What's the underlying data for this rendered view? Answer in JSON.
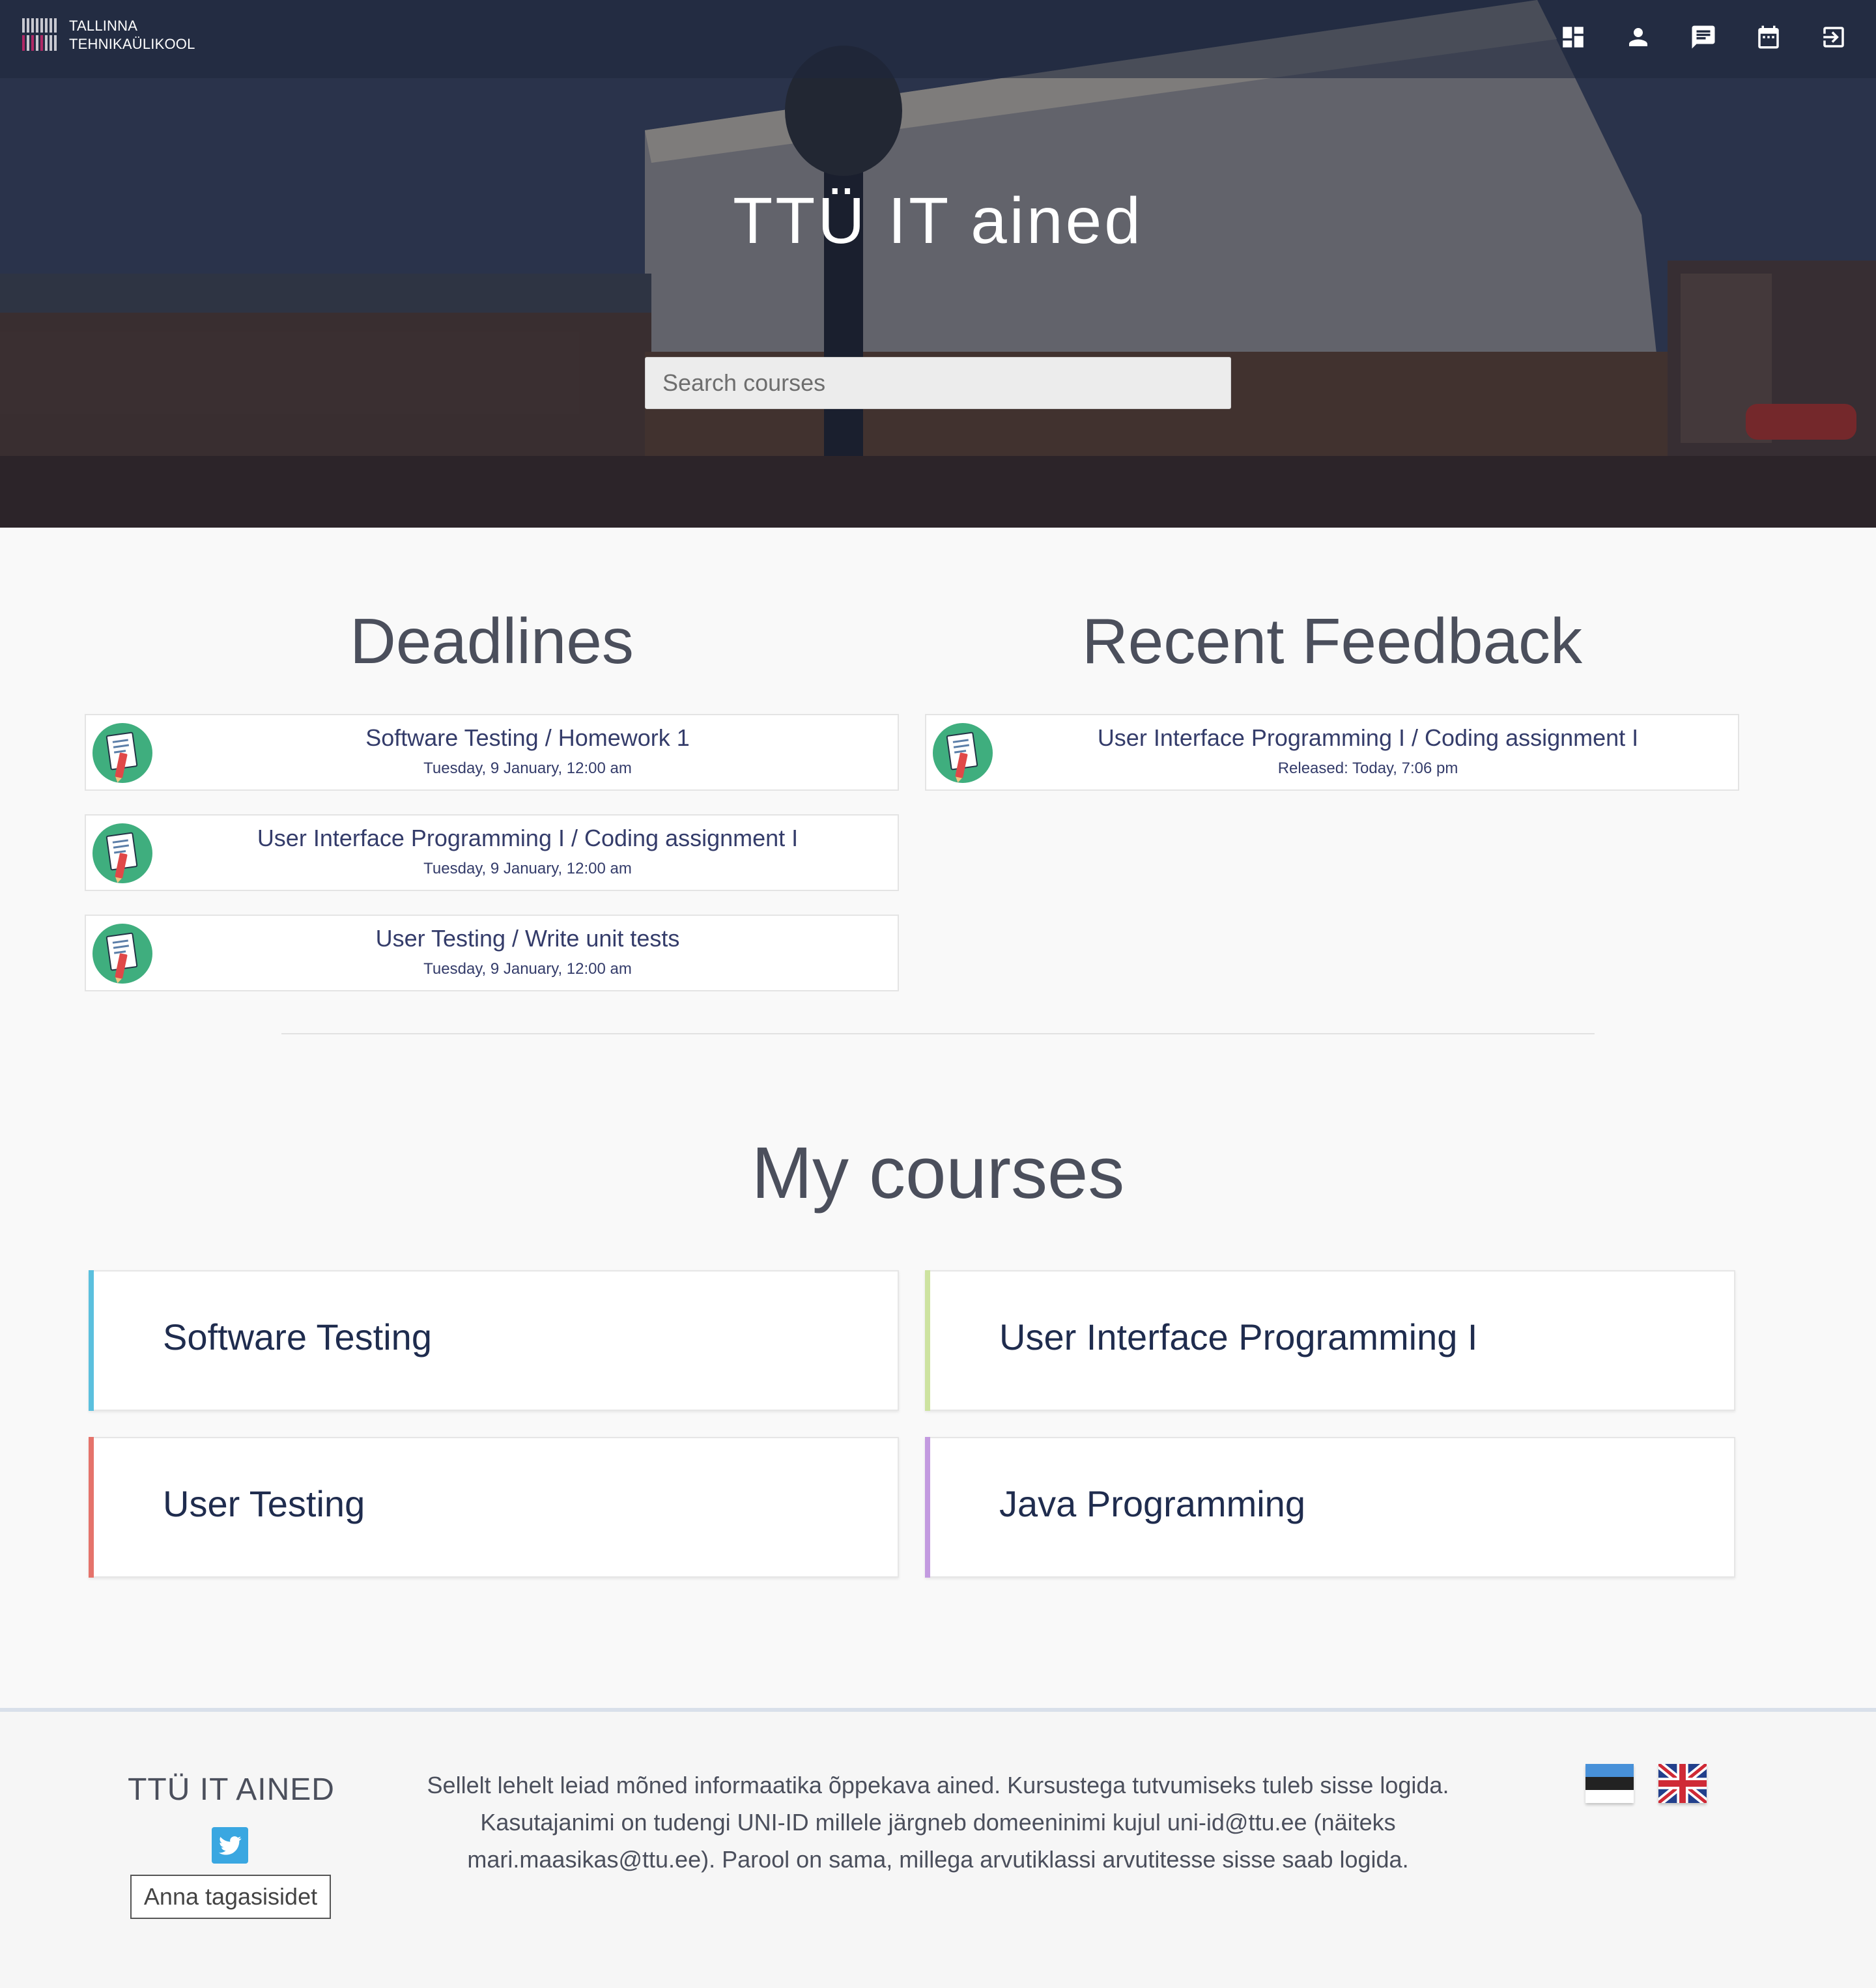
{
  "header": {
    "logo_line1": "TALLINNA",
    "logo_line2": "TEHNIKAÜLIKOOL",
    "icons": [
      "dashboard-icon",
      "profile-icon",
      "messages-icon",
      "calendar-icon",
      "logout-icon"
    ]
  },
  "hero": {
    "title": "TTÜ IT ained",
    "search_placeholder": "Search courses"
  },
  "deadlines": {
    "title": "Deadlines",
    "items": [
      {
        "title": "Software Testing / Homework 1",
        "date": "Tuesday, 9 January, 12:00 am"
      },
      {
        "title": "User Interface Programming I / Coding assignment I",
        "date": "Tuesday, 9 January, 12:00 am"
      },
      {
        "title": "User Testing / Write unit tests",
        "date": "Tuesday, 9 January, 12:00 am"
      }
    ]
  },
  "feedback": {
    "title": "Recent Feedback",
    "items": [
      {
        "title": "User Interface Programming I / Coding assignment I",
        "date": "Released: Today, 7:06 pm"
      }
    ]
  },
  "courses": {
    "title": "My courses",
    "items": [
      {
        "name": "Software Testing",
        "color": "#5bc0de"
      },
      {
        "name": "User Interface Programming I",
        "color": "#cde3a0"
      },
      {
        "name": "User Testing",
        "color": "#e5736b"
      },
      {
        "name": "Java Programming",
        "color": "#c39be0"
      }
    ]
  },
  "footer": {
    "brand": "TTÜ IT AINED",
    "feedback_button": "Anna tagasisidet",
    "text": "Sellelt lehelt leiad mõned informaatika õppekava ained. Kursustega tutvumiseks tuleb sisse logida. Kasutajanimi on tudengi UNI-ID millele järgneb domeeninimi kujul uni-id@ttu.ee (näiteks mari.maasikas@ttu.ee). Parool on sama, millega arvutiklassi arvutitesse sisse saab logida.",
    "languages": [
      "Estonian",
      "English"
    ]
  }
}
